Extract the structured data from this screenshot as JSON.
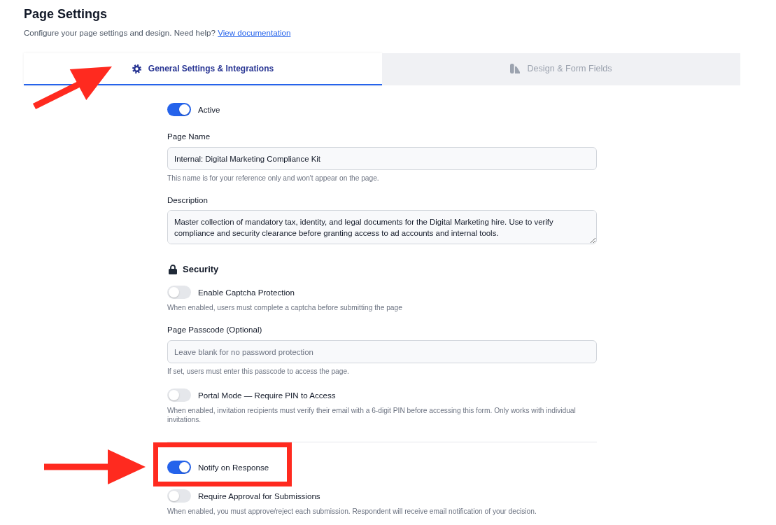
{
  "page": {
    "title": "Page Settings",
    "subtitle": "Configure your page settings and design. Need help?",
    "help_link": "View documentation"
  },
  "tabs": [
    {
      "label": "General Settings & Integrations",
      "selected": true,
      "pointed_at": true
    },
    {
      "label": "Design & Form Fields",
      "selected": false,
      "pointed_at": false
    }
  ],
  "settings": [
    {
      "kind": "toggle",
      "label": "Active",
      "on": true,
      "highlighted": false,
      "pointed_at": false
    },
    {
      "kind": "field",
      "label": "Page Name",
      "value": "Internal: Digital Marketing Compliance Kit",
      "hint": "This name is for your reference only and won't appear on the page."
    },
    {
      "kind": "textarea",
      "label": "Description",
      "value": "Master collection of mandatory tax, identity, and legal documents for the Digital Marketing hire. Use to verify compliance and security clearance before granting access to ad accounts and internal tools."
    },
    {
      "kind": "heading",
      "label": "Security"
    },
    {
      "kind": "toggle",
      "label": "Enable Captcha Protection",
      "on": false,
      "highlighted": false,
      "pointed_at": false,
      "hint": "When enabled, users must complete a captcha before submitting the page"
    },
    {
      "kind": "field",
      "label": "Page Passcode (Optional)",
      "placeholder": "Leave blank for no password protection",
      "hint": "If set, users must enter this passcode to access the page."
    },
    {
      "kind": "toggle",
      "label": "Portal Mode — Require PIN to Access",
      "on": false,
      "highlighted": false,
      "pointed_at": false,
      "hint": "When enabled, invitation recipients must verify their email with a 6-digit PIN before accessing this form. Only works with individual invitations."
    },
    {
      "kind": "divider"
    },
    {
      "kind": "toggle",
      "label": "Notify on Response",
      "on": true,
      "highlighted": true,
      "pointed_at": true
    },
    {
      "kind": "toggle",
      "label": "Require Approval for Submissions",
      "on": false,
      "highlighted": false,
      "pointed_at": false,
      "hint": "When enabled, you must approve/reject each submission. Respondent will receive email notification of your decision."
    }
  ]
}
